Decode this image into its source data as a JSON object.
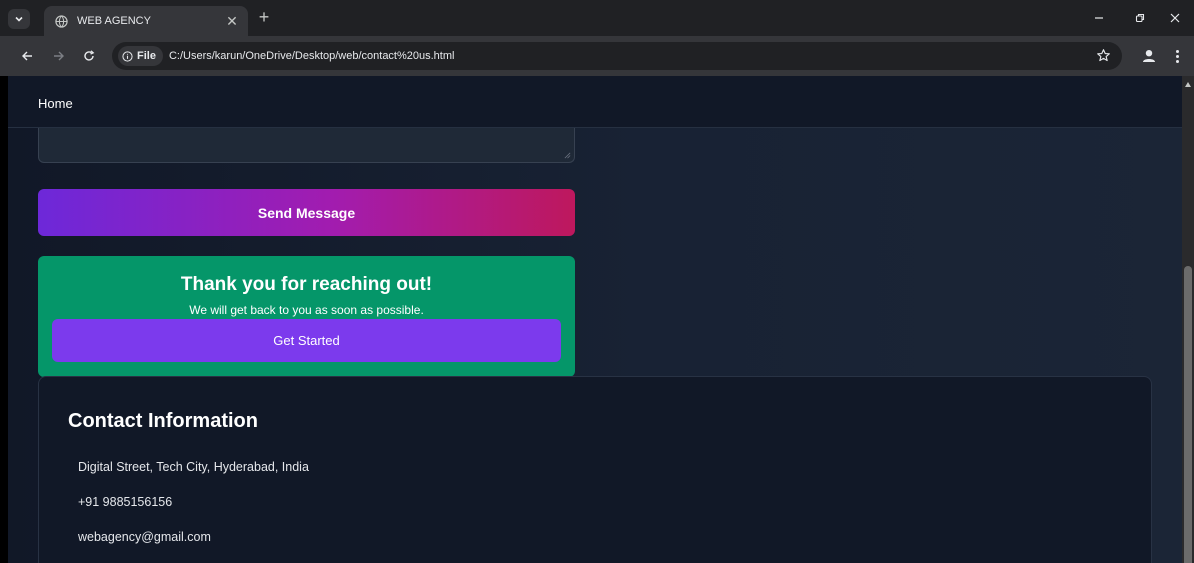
{
  "browser": {
    "tab_title": "WEB AGENCY",
    "site_info_label": "File",
    "url": "C:/Users/karun/OneDrive/Desktop/web/contact%20us.html"
  },
  "nav": {
    "home_label": "Home"
  },
  "form": {
    "send_label": "Send Message"
  },
  "thanks": {
    "title": "Thank you for reaching out!",
    "subtitle": "We will get back to you as soon as possible.",
    "cta_label": "Get Started"
  },
  "contact": {
    "heading": "Contact Information",
    "address": "Digital Street, Tech City, Hyderabad, India",
    "phone": "+91 9885156156",
    "email": "webagency@gmail.com"
  },
  "colors": {
    "send_gradient_start": "#6d28d9",
    "send_gradient_end": "#be185d",
    "thanks_bg": "#059669",
    "cta_bg": "#7c3aed",
    "page_bg": "#111827"
  },
  "icons": [
    "chevron-down-icon",
    "globe-icon",
    "close-icon",
    "plus-icon",
    "minimize-icon",
    "restore-icon",
    "back-arrow-icon",
    "forward-arrow-icon",
    "reload-icon",
    "info-icon",
    "star-icon",
    "profile-icon",
    "more-icon"
  ]
}
